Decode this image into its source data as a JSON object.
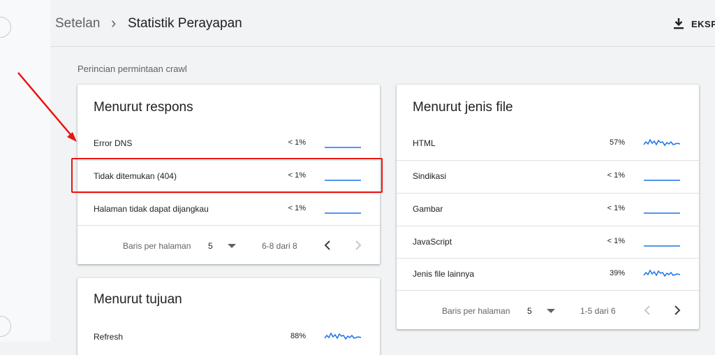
{
  "header": {
    "breadcrumb_parent": "Setelan",
    "breadcrumb_separator": "›",
    "page_title": "Statistik Perayapan",
    "export_label": "EKSP"
  },
  "section_title": "Perincian permintaan crawl",
  "card_response": {
    "title": "Menurut respons",
    "rows": [
      {
        "label": "Error DNS",
        "pct": "< 1%"
      },
      {
        "label": "Tidak ditemukan (404)",
        "pct": "< 1%"
      },
      {
        "label": "Halaman tidak dapat dijangkau",
        "pct": "< 1%"
      }
    ],
    "pager": {
      "rows_label": "Baris per halaman",
      "rows_value": "5",
      "range": "6-8 dari 8"
    }
  },
  "card_purpose": {
    "title": "Menurut tujuan",
    "rows": [
      {
        "label": "Refresh",
        "pct": "88%"
      }
    ]
  },
  "card_filetype": {
    "title": "Menurut jenis file",
    "rows": [
      {
        "label": "HTML",
        "pct": "57%"
      },
      {
        "label": "Sindikasi",
        "pct": "< 1%"
      },
      {
        "label": "Gambar",
        "pct": "< 1%"
      },
      {
        "label": "JavaScript",
        "pct": "< 1%"
      },
      {
        "label": "Jenis file lainnya",
        "pct": "39%"
      }
    ],
    "pager": {
      "rows_label": "Baris per halaman",
      "rows_value": "5",
      "range": "1-5 dari 6"
    }
  },
  "colors": {
    "sparkline": "#1a73e8",
    "annotation": "#ee1111"
  },
  "icons": [
    "download-icon",
    "dropdown-arrow-icon",
    "chevron-left-icon",
    "chevron-right-icon",
    "sparkline-icon"
  ]
}
